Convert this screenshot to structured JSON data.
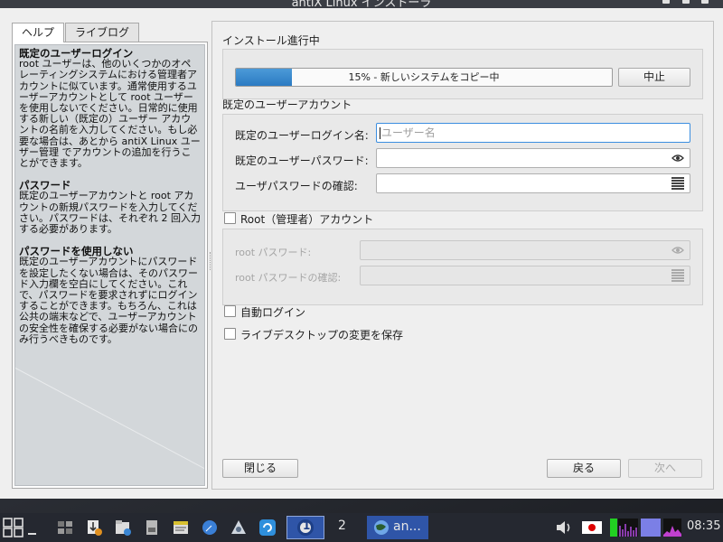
{
  "window": {
    "title": "antiX Linux インストーラ"
  },
  "tabs": [
    {
      "label": "ヘルプ",
      "active": true
    },
    {
      "label": "ライブログ",
      "active": false
    }
  ],
  "help": [
    {
      "heading": "既定のユーザーログイン",
      "body": "root ユーザーは、他のいくつかのオペレーティングシステムにおける管理者アカウントに似ています。通常使用するユーザーアカウントとして root ユーザーを使用しないでください。日常的に使用する新しい（既定の）ユーザー アカウントの名前を入力してください。もし必要な場合は、あとから antiX Linux ユーザー管理 でアカウントの追加を行うことができます。"
    },
    {
      "heading": "パスワード",
      "body": "既定のユーザーアカウントと root アカウントの新規パスワードを入力してください。パスワードは、それぞれ 2 回入力する必要があります。"
    },
    {
      "heading": "パスワードを使用しない",
      "body": "既定のユーザーアカウントにパスワードを設定したくない場合は、そのパスワード入力欄を空白にしてください。これで、パスワードを要求されずにログインすることができます。もちろん、これは公共の端末などで、ユーザーアカウントの安全性を確保する必要がない場合にのみ行うべきものです。"
    }
  ],
  "install": {
    "section_label": "インストール進行中",
    "progress_percent": 15,
    "progress_text": "15% - 新しいシステムをコピー中",
    "abort_label": "中止"
  },
  "user": {
    "section_label": "既定のユーザーアカウント",
    "login_label": "既定のユーザーログイン名:",
    "login_placeholder": "ユーザー名",
    "password_label": "既定のユーザーパスワード:",
    "confirm_label": "ユーザパスワードの確認:"
  },
  "root": {
    "checkbox_label": "Root（管理者）アカウント",
    "checked": false,
    "password_label": "root パスワード:",
    "confirm_label": "root パスワードの確認:"
  },
  "options": {
    "autologin_label": "自動ログイン",
    "autologin_checked": false,
    "save_desktop_label": "ライブデスクトップの変更を保存",
    "save_desktop_checked": false
  },
  "buttons": {
    "close": "閉じる",
    "back": "戻る",
    "next": "次へ"
  },
  "taskbar": {
    "workspace_1": "1",
    "workspace_2": "2",
    "active_task_label": "an...",
    "clock": "08:35"
  },
  "colors": {
    "accent": "#2b7bc2",
    "taskbar": "#252830",
    "active_task": "#2f55a8"
  }
}
